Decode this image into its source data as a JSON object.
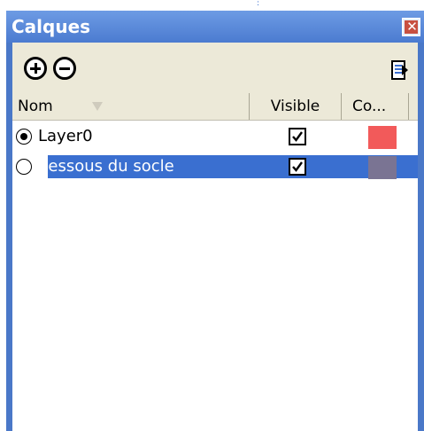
{
  "window": {
    "title": "Calques"
  },
  "toolbar": {
    "add_icon": "plus-circle-icon",
    "remove_icon": "minus-circle-icon",
    "details_icon": "details-arrow-icon"
  },
  "columns": {
    "name": "Nom",
    "visible": "Visible",
    "color": "Co..."
  },
  "layers": [
    {
      "name": "Layer0",
      "active": true,
      "visible": true,
      "color": "#f25a5a",
      "selected": false
    },
    {
      "name": "dessous du socle",
      "active": false,
      "visible": true,
      "color": "#7a7493",
      "selected": true
    }
  ],
  "colors": {
    "selection": "#3a6fd0",
    "titlebar": "#4b7bd0",
    "panel": "#ece9d8"
  }
}
